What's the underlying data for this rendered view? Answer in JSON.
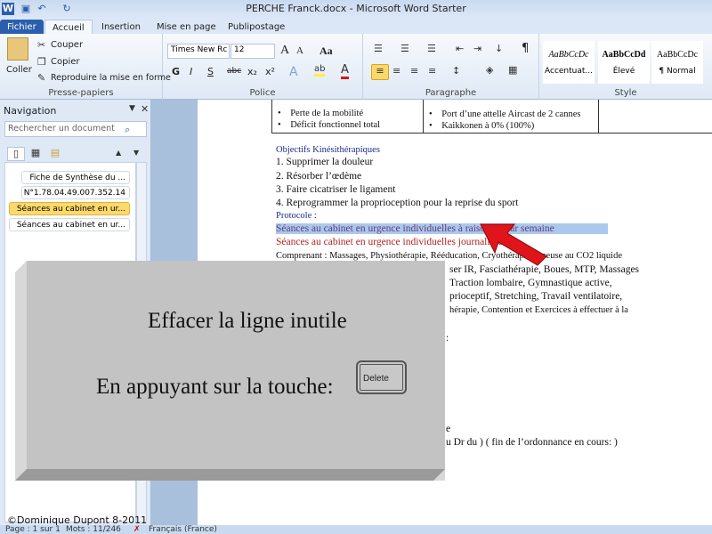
{
  "window": {
    "title": "PERCHE Franck.docx  -  Microsoft Word Starter"
  },
  "tabs": [
    "Fichier",
    "Accueil",
    "Insertion",
    "Mise en page",
    "Publipostage"
  ],
  "ribbon": {
    "clipboard": {
      "paste": "Coller",
      "cut": "Couper",
      "copy": "Copier",
      "format_painter": "Reproduire la mise en forme",
      "label": "Presse-papiers"
    },
    "font": {
      "name": "Times New Rc",
      "size": "12",
      "bold": "G",
      "italic": "I",
      "underline": "S",
      "strike": "abc",
      "sub": "x₂",
      "sup": "x²",
      "case": "Aa",
      "grow": "A",
      "shrink": "A",
      "label": "Police"
    },
    "paragraph": {
      "label": "Paragraphe",
      "pilcrow": "¶"
    },
    "styles": {
      "items": [
        {
          "preview": "AaBbCcDc",
          "name": "Accentuat..."
        },
        {
          "preview": "AaBbCcDd",
          "name": "Élevé"
        },
        {
          "preview": "AaBbCcDc",
          "name": "¶ Normal"
        }
      ],
      "label": "Style"
    }
  },
  "navigation": {
    "title": "Navigation",
    "search_placeholder": "Rechercher un document",
    "items": [
      "Fiche de Synthèse du ...",
      "N°1.78.04.49.007.352.14",
      "Séances au cabinet en ur...",
      "Séances au cabinet en ur..."
    ],
    "selected_index": 2
  },
  "document": {
    "table_rows": [
      [
        "Perte de la mobilité",
        "Port d’une attelle Aircast de 2 cannes"
      ],
      [
        "Déficit fonctionnel total",
        "Kaikkonen à 0% (100%)"
      ]
    ],
    "objectives_title": "Objectifs Kinésithérapiques",
    "objectives": [
      "1.   Supprimer  la douleur",
      "2.   Résorber l’œdème",
      "3.   Faire cicatriser  le ligament",
      "4.   Reprogrammer  la proprioception  pour la reprise du sport"
    ],
    "protocol_title": "Protocole :",
    "highlighted_line": "Séances au cabinet en urgence  individuelles  à raison de par semaine",
    "red_line": "Séances au cabinet en urgence  individuelles  journalières",
    "body_lines": [
      "Comprenant  : Massages, Physiothérapie,  Rééducation, Cryothérapie  gazeuse au CO2 liquide",
      "ser IR, Fasciathérapie,  Boues, MTP, Massages",
      "Traction lombaire,  Gymnastique  active,",
      "prioceptif,  Stretching,  Travail  ventilatoire,",
      "hérapie,  Contention  et Exercices  à effectuer  à la",
      ":",
      "e",
      "u Dr du ) ( fin  de l’ordonnance  en cours:  )"
    ]
  },
  "overlay": {
    "line1": "Effacer la ligne inutile",
    "line2": "En appuyant  sur  la touche:",
    "key": "Delete"
  },
  "copyright": "©Dominique Dupont  8-2011",
  "status": {
    "page": "Page : 1 sur 1",
    "words": "Mots : 11/246",
    "language": "Français (France)"
  },
  "colors": {
    "highlight": "#a9c8ec",
    "red_text": "#b22222",
    "arrow": "#e0141b",
    "file_tab": "#2b5fad"
  }
}
